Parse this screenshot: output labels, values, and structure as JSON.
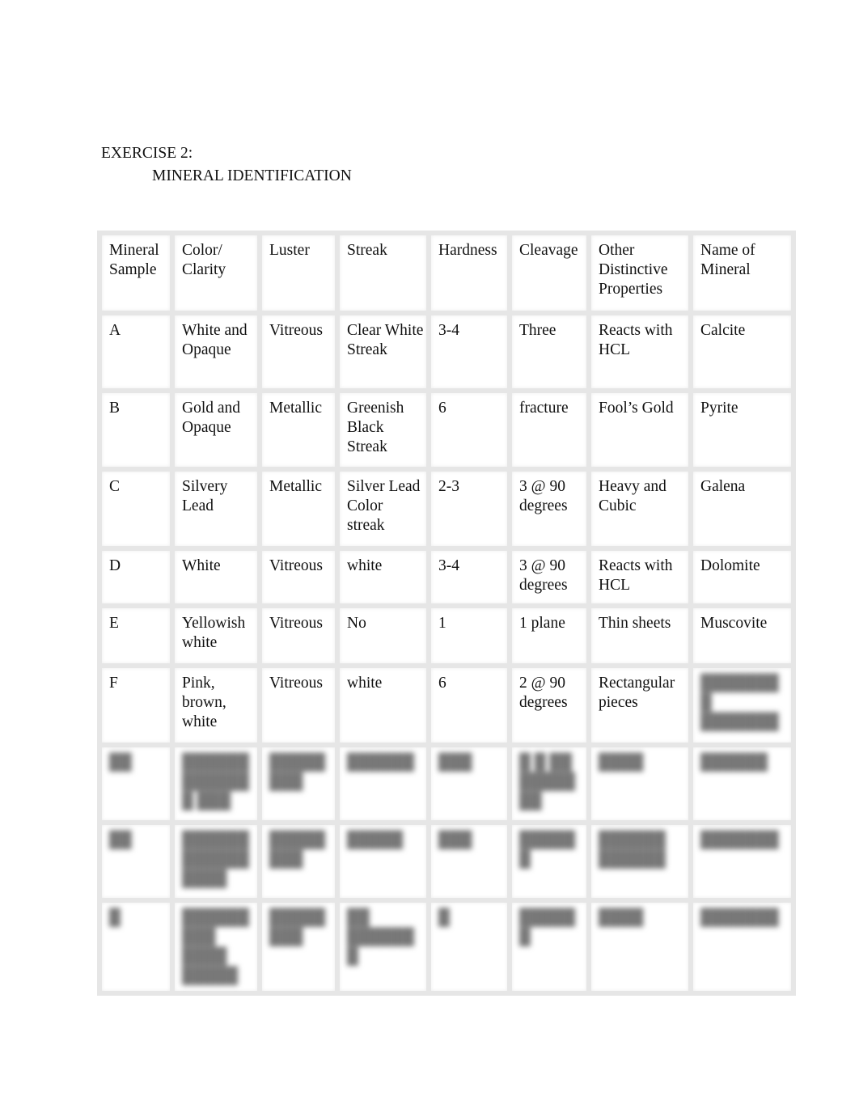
{
  "document": {
    "exercise_label": "EXERCISE 2:",
    "section_title": "MINERAL IDENTIFICATION"
  },
  "table": {
    "headers": [
      "Mineral Sample",
      "Color/ Clarity",
      "Luster",
      "Streak",
      "Hardness",
      "Cleavage",
      "Other Distinctive Properties",
      "Name of Mineral"
    ],
    "rows": [
      {
        "sample": "A",
        "color": "White and Opaque",
        "luster": "Vitreous",
        "streak": "Clear White Streak",
        "hardness": "3-4",
        "cleavage": "Three",
        "other": "Reacts with HCL",
        "name": "Calcite"
      },
      {
        "sample": "B",
        "color": "Gold and Opaque",
        "luster": "Metallic",
        "streak": "Greenish Black Streak",
        "hardness": "6",
        "cleavage": "fracture",
        "other": "Fool’s Gold",
        "name": "Pyrite"
      },
      {
        "sample": "C",
        "color": "Silvery Lead",
        "luster": "Metallic",
        "streak": "Silver Lead Color streak",
        "hardness": "2-3",
        "cleavage": "3 @ 90 degrees",
        "other": "Heavy and Cubic",
        "name": "Galena"
      },
      {
        "sample": "D",
        "color": "White",
        "luster": "Vitreous",
        "streak": "white",
        "hardness": "3-4",
        "cleavage": "3 @ 90 degrees",
        "other": "Reacts with HCL",
        "name": "Dolomite"
      },
      {
        "sample": "E",
        "color": "Yellowish white",
        "luster": "Vitreous",
        "streak": "No",
        "hardness": "1",
        "cleavage": "1 plane",
        "other": "Thin sheets",
        "name": "Muscovite"
      },
      {
        "sample": "F",
        "color": "Pink, brown, white",
        "luster": "Vitreous",
        "streak": "white",
        "hardness": "6",
        "cleavage": "2 @ 90 degrees",
        "other": "Rectangular pieces",
        "name": "████████ ███████"
      }
    ],
    "blurred_rows": [
      {
        "sample": "██",
        "color": "██████ ███████ ███",
        "luster": "████████",
        "streak": "██████",
        "hardness": "███",
        "cleavage": "█ █ ██ ███████",
        "other": "████",
        "name": "██████"
      },
      {
        "sample": "██",
        "color": "██████ ██████ ████",
        "luster": "████████",
        "streak": "█████",
        "hardness": "███",
        "cleavage": "██████",
        "other": "██████ ██████",
        "name": "███████"
      },
      {
        "sample": "█",
        "color": "█████████ ████ █████",
        "luster": "████████",
        "streak": "██ ███████",
        "hardness": "█",
        "cleavage": "██████",
        "other": "████",
        "name": "███████"
      }
    ]
  }
}
